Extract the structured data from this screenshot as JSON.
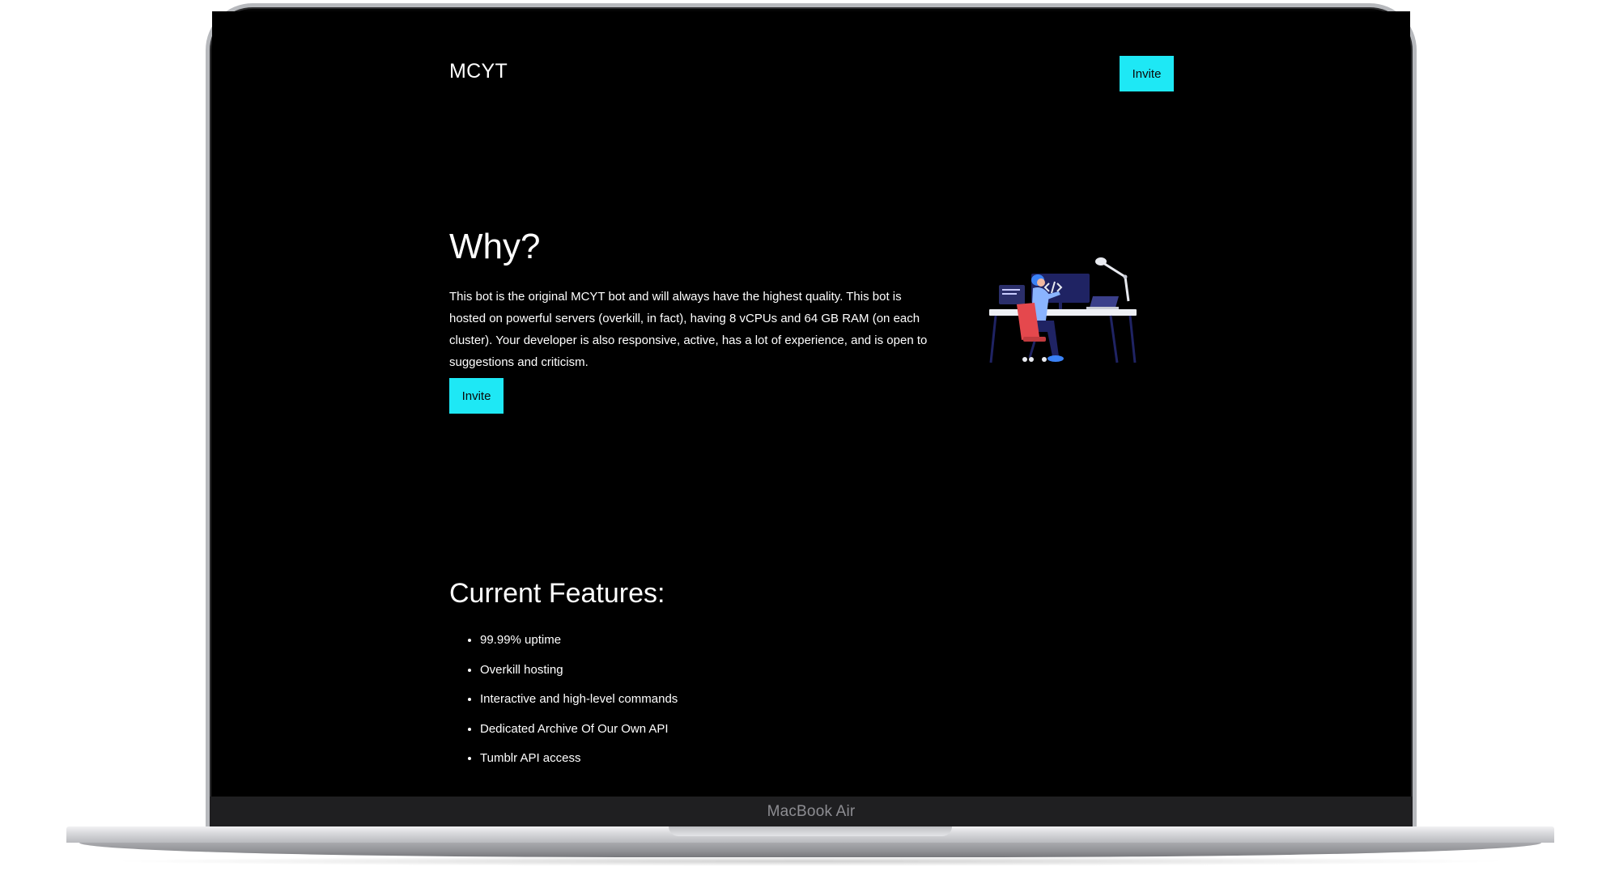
{
  "site": {
    "logo": "MCYT",
    "header_invite": "Invite"
  },
  "why": {
    "title": "Why?",
    "body": "This bot is the original MCYT bot and will always have the highest quality. This bot is hosted on powerful servers (overkill, in fact), having 8 vCPUs and 64 GB RAM (on each cluster). Your developer is also responsive, active, has a lot of experience, and is open to suggestions and criticism.",
    "invite": "Invite"
  },
  "features": {
    "title": "Current Features:",
    "items": [
      "99.99% uptime",
      "Overkill hosting",
      "Interactive and high-level commands",
      "Dedicated Archive Of Our Own API",
      "Tumblr API access"
    ]
  },
  "device": {
    "label": "MacBook Air"
  },
  "colors": {
    "accent": "#1EE8F5",
    "background": "#000000",
    "text": "#FFFFFF"
  },
  "icons": {
    "illustration": "developer-at-desk-illustration",
    "code_symbol": "code-icon"
  }
}
